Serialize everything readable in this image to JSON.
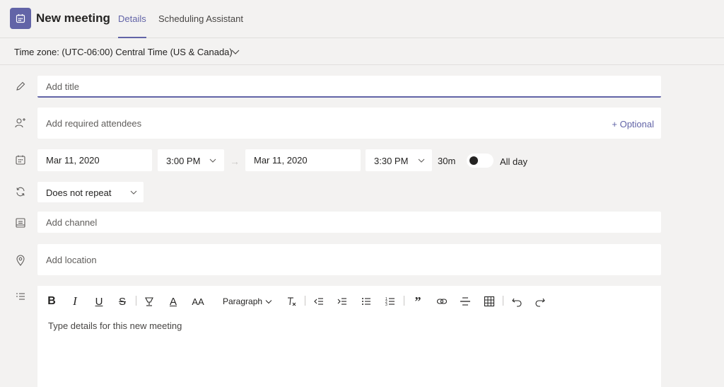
{
  "header": {
    "title": "New meeting",
    "tabs": [
      {
        "label": "Details",
        "active": true
      },
      {
        "label": "Scheduling Assistant",
        "active": false
      }
    ]
  },
  "timezone": {
    "label": "Time zone: (UTC-06:00) Central Time (US & Canada)"
  },
  "form": {
    "title_placeholder": "Add title",
    "attendees_placeholder": "Add required attendees",
    "optional_link": "+ Optional",
    "start_date": "Mar 11, 2020",
    "start_time": "3:00 PM",
    "end_date": "Mar 11, 2020",
    "end_time": "3:30 PM",
    "duration": "30m",
    "all_day_label": "All day",
    "all_day_on": false,
    "repeat": "Does not repeat",
    "channel_placeholder": "Add channel",
    "location_placeholder": "Add location"
  },
  "editor": {
    "toolbar": {
      "bold": "B",
      "italic": "I",
      "underline": "U",
      "strike": "S",
      "font_color": "A",
      "font_size": "AA",
      "paragraph": "Paragraph"
    },
    "placeholder": "Type details for this new meeting"
  },
  "colors": {
    "accent": "#6264a7",
    "background": "#f3f2f1",
    "field": "#ffffff"
  }
}
